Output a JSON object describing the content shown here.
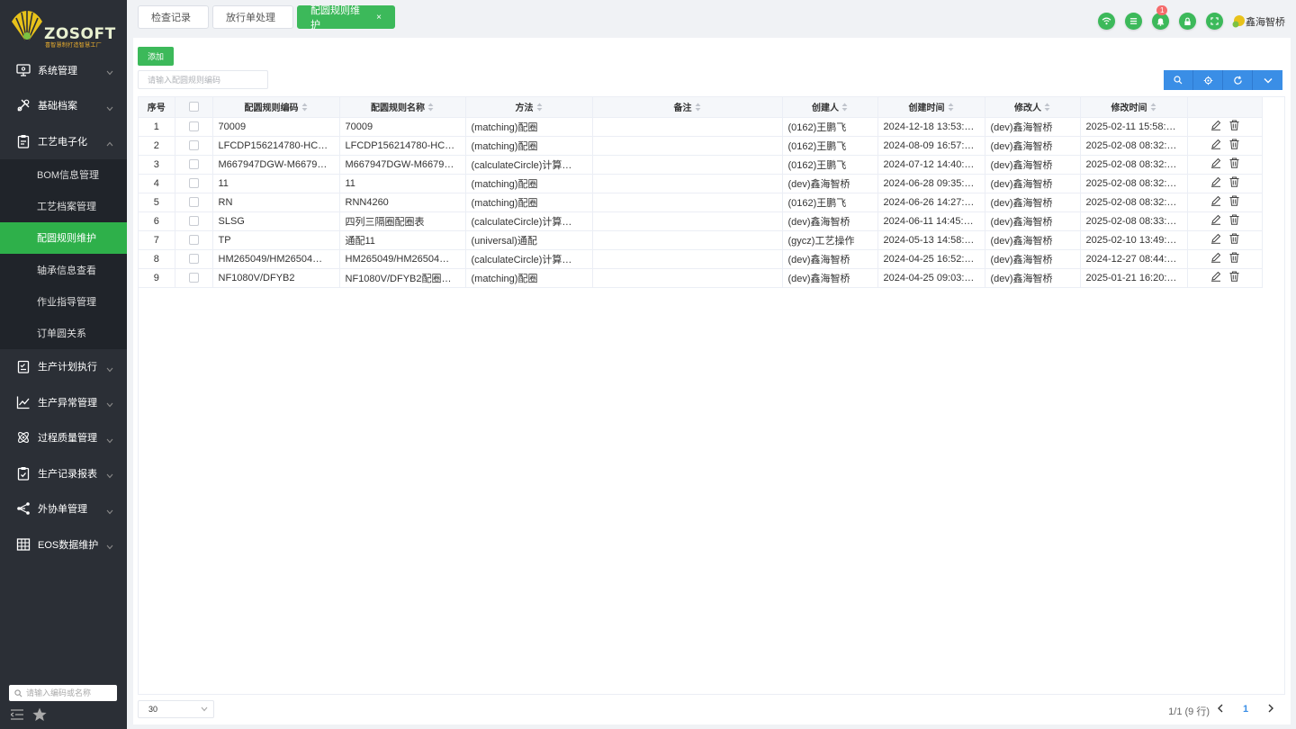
{
  "brand": {
    "name": "ZOSOFT",
    "tagline": "喜智慧制打造智慧工厂"
  },
  "sidebar": {
    "groups_top": [
      {
        "label": "系统管理",
        "icon": "monitor-icon"
      },
      {
        "label": "基础档案",
        "icon": "tools-icon"
      },
      {
        "label": "工艺电子化",
        "icon": "clipboard-icon"
      }
    ],
    "sub_items": [
      {
        "label": "BOM信息管理"
      },
      {
        "label": "工艺档案管理"
      },
      {
        "label": "配圆规则维护"
      },
      {
        "label": "轴承信息查看"
      },
      {
        "label": "作业指导管理"
      },
      {
        "label": "订单圆关系"
      }
    ],
    "groups_bottom": [
      {
        "label": "生产计划执行",
        "icon": "checklist-icon"
      },
      {
        "label": "生产异常管理",
        "icon": "line-chart-icon"
      },
      {
        "label": "过程质量管理",
        "icon": "atom-icon"
      },
      {
        "label": "生产记录报表",
        "icon": "clipboard-check-icon"
      },
      {
        "label": "外协单管理",
        "icon": "share-icon"
      },
      {
        "label": "EOS数据维护",
        "icon": "grid-icon"
      }
    ],
    "search_placeholder": "请输入编码或名称"
  },
  "tabs": [
    {
      "label": "检查记录"
    },
    {
      "label": "放行单处理"
    },
    {
      "label": "配圆规则维护",
      "close": "×"
    }
  ],
  "header": {
    "badge_count": "1",
    "user_name": "鑫海智桥"
  },
  "toolbar": {
    "add_label": "添加",
    "search_placeholder": "请输入配圆规则编码"
  },
  "table": {
    "columns": [
      "序号",
      "配圆规则编码",
      "配圆规则名称",
      "方法",
      "备注",
      "创建人",
      "创建时间",
      "修改人",
      "修改时间"
    ],
    "rows": [
      [
        "1",
        "70009",
        "70009",
        "(matching)配圈",
        "",
        "(0162)王鹏飞",
        "2024-12-18 13:53:…",
        "(dev)鑫海智桥",
        "2025-02-11 15:58:…"
      ],
      [
        "2",
        "LFCDP156214780-HCE…",
        "LFCDP156214780-HCE…",
        "(matching)配圈",
        "",
        "(0162)王鹏飞",
        "2024-08-09 16:57:…",
        "(dev)鑫海智桥",
        "2025-02-08 08:32:…"
      ],
      [
        "3",
        "M667947DGW-M6679…",
        "M667947DGW-M6679…",
        "(calculateCircle)计算…",
        "",
        "(0162)王鹏飞",
        "2024-07-12 14:40:…",
        "(dev)鑫海智桥",
        "2025-02-08 08:32:…"
      ],
      [
        "4",
        "11",
        "11",
        "(matching)配圈",
        "",
        "(dev)鑫海智桥",
        "2024-06-28 09:35:…",
        "(dev)鑫海智桥",
        "2025-02-08 08:32:…"
      ],
      [
        "5",
        "RN",
        "RNN4260",
        "(matching)配圈",
        "",
        "(0162)王鹏飞",
        "2024-06-26 14:27:…",
        "(dev)鑫海智桥",
        "2025-02-08 08:32:…"
      ],
      [
        "6",
        "SLSG",
        "四列三隔圈配圈表",
        "(calculateCircle)计算…",
        "",
        "(dev)鑫海智桥",
        "2024-06-11 14:45:…",
        "(dev)鑫海智桥",
        "2025-02-08 08:33:…"
      ],
      [
        "7",
        "TP",
        "通配11",
        "(universal)通配",
        "",
        "(gycz)工艺操作",
        "2024-05-13 14:58:…",
        "(dev)鑫海智桥",
        "2025-02-10 13:49:…"
      ],
      [
        "8",
        "HM265049/HM26504…",
        "HM265049/HM26504…",
        "(calculateCircle)计算…",
        "",
        "(dev)鑫海智桥",
        "2024-04-25 16:52:…",
        "(dev)鑫海智桥",
        "2024-12-27 08:44:…"
      ],
      [
        "9",
        "NF1080V/DFYB2",
        "NF1080V/DFYB2配圈…",
        "(matching)配圈",
        "",
        "(dev)鑫海智桥",
        "2024-04-25 09:03:…",
        "(dev)鑫海智桥",
        "2025-01-21 16:20:…"
      ]
    ]
  },
  "pagination": {
    "page_size": "30",
    "info": "1/1 (9 行)",
    "current_page": "1"
  },
  "colors": {
    "accent_green": "#3cb95a",
    "accent_blue": "#3a8ee6",
    "sidebar_bg": "#2b2f36"
  }
}
